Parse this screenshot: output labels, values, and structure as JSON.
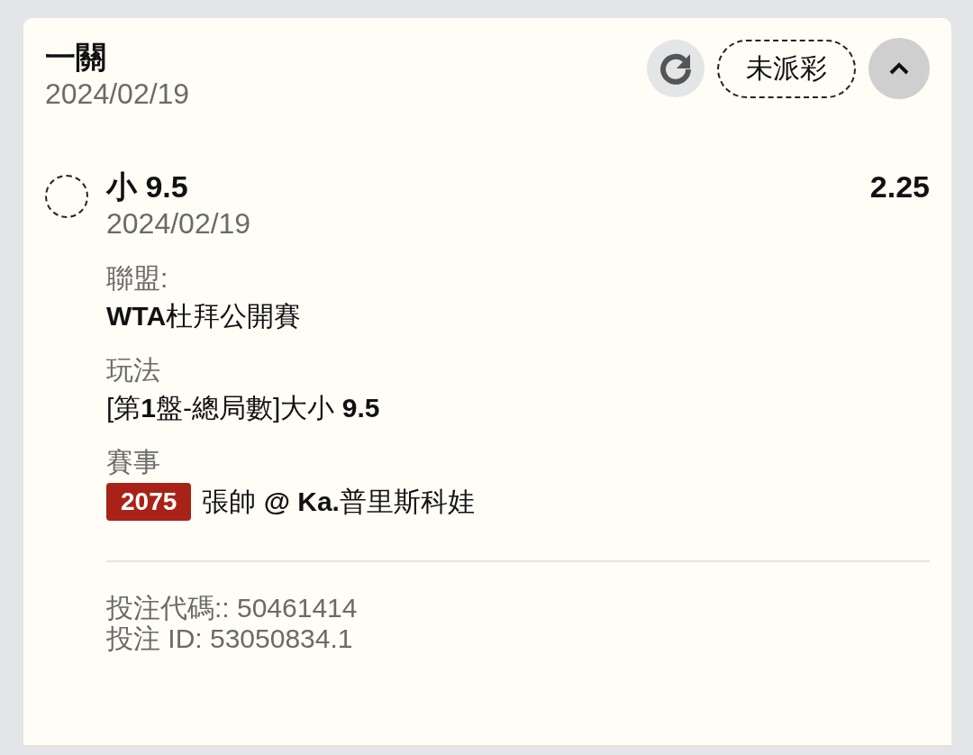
{
  "header": {
    "title": "一關",
    "date": "2024/02/19",
    "status": "未派彩",
    "expanded": true
  },
  "selection": {
    "selected": false,
    "name": "小 9.5",
    "date": "2024/02/19",
    "odds": "2.25"
  },
  "details": [
    {
      "label": "聯盟:",
      "value": "**WTA**杜拜公開賽"
    },
    {
      "label": "玩法",
      "value": "[第**1**盤-總局數]大小 **9.5**"
    },
    {
      "label": "賽事",
      "badge": "2075",
      "value": "張帥 **@ Ka.**普里斯科娃"
    }
  ],
  "footer": [
    "投注代碼:: 50461414",
    "投注 ID: 53050834.1"
  ]
}
